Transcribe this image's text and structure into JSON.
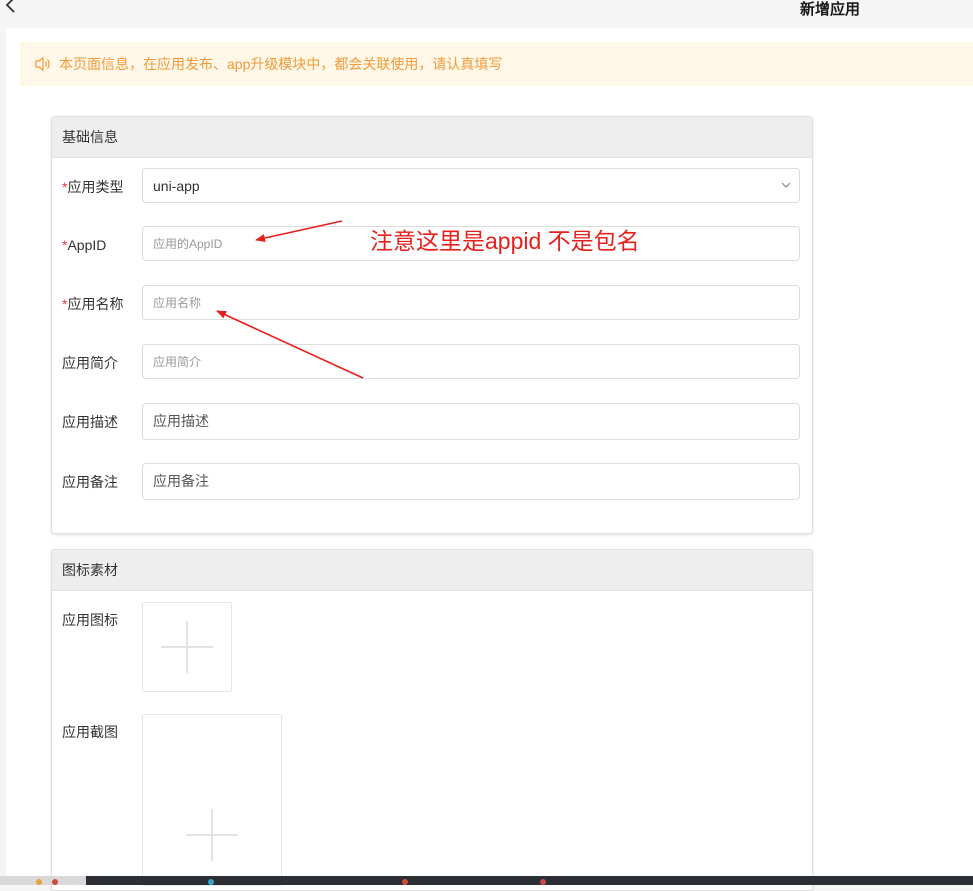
{
  "header": {
    "back_icon": "chevron-left-icon",
    "title": "新增应用"
  },
  "notice": {
    "icon": "speaker-icon",
    "text": "本页面信息，在应用发布、app升级模块中，都会关联使用，请认真填写",
    "color": "#f29a39"
  },
  "basic_info": {
    "title": "基础信息",
    "app_type": {
      "required_mark": "*",
      "label": "应用类型",
      "value": "uni-app"
    },
    "app_id": {
      "required_mark": "*",
      "label": "AppID",
      "placeholder": "应用的AppID"
    },
    "app_name": {
      "required_mark": "*",
      "label": "应用名称",
      "placeholder": "应用名称"
    },
    "app_intro": {
      "label": "应用简介",
      "placeholder": "应用简介"
    },
    "app_desc": {
      "label": "应用描述",
      "placeholder": "应用描述"
    },
    "app_remark": {
      "label": "应用备注",
      "placeholder": "应用备注"
    }
  },
  "icon_material": {
    "title": "图标素材",
    "app_icon_label": "应用图标",
    "app_screenshot_label": "应用截图"
  },
  "annotation": {
    "text": "注意这里是appid 不是包名",
    "color": "#e8201c"
  }
}
